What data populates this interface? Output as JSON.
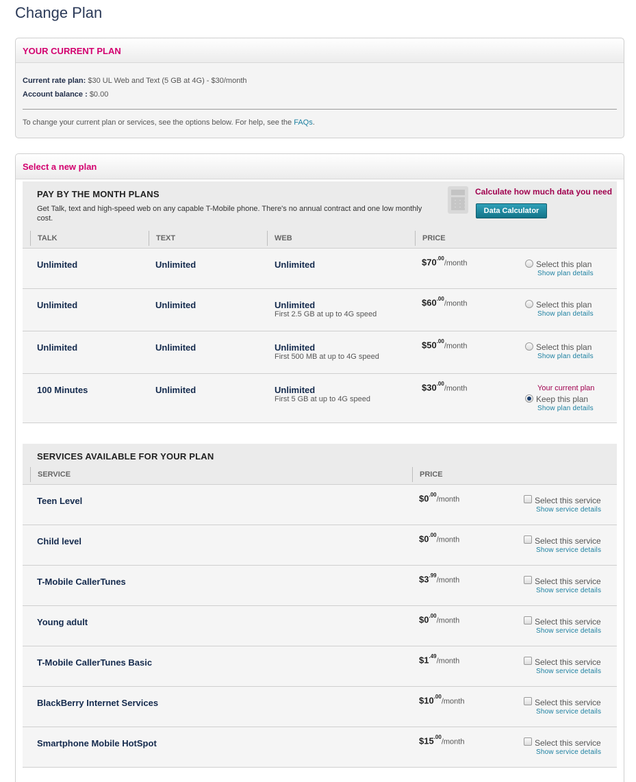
{
  "page_title": "Change Plan",
  "current_plan": {
    "heading": "YOUR CURRENT PLAN",
    "rate_plan_label": "Current rate plan:",
    "rate_plan_value": "$30 UL Web and Text (5 GB at 4G) - $30/month",
    "balance_label": "Account balance :",
    "balance_value": "$0.00",
    "help_text": "To change your current plan or services, see the options below. For help, see the",
    "help_link": "FAQs",
    "help_end": "."
  },
  "new_plan": {
    "heading": "Select a new plan",
    "month_plans": {
      "title": "PAY BY THE MONTH PLANS",
      "description": "Get Talk, text and high-speed web on any capable T-Mobile phone. There's no annual contract and one low monthly cost.",
      "calc_label": "Calculate how much data you need",
      "calc_button": "Data Calculator",
      "columns": [
        "TALK",
        "TEXT",
        "WEB",
        "PRICE"
      ],
      "rows": [
        {
          "talk": "Unlimited",
          "text": "Unlimited",
          "web": "Unlimited",
          "web_note": "",
          "price_main": "$70",
          "price_cents": ".00",
          "price_per": "/month",
          "note": "",
          "option": "Select this plan",
          "details": "Show plan details",
          "selected": false
        },
        {
          "talk": "Unlimited",
          "text": "Unlimited",
          "web": "Unlimited",
          "web_note": "First 2.5 GB at up to 4G speed",
          "price_main": "$60",
          "price_cents": ".00",
          "price_per": "/month",
          "note": "",
          "option": "Select this plan",
          "details": "Show plan details",
          "selected": false
        },
        {
          "talk": "Unlimited",
          "text": "Unlimited",
          "web": "Unlimited",
          "web_note": "First 500 MB at up to 4G speed",
          "price_main": "$50",
          "price_cents": ".00",
          "price_per": "/month",
          "note": "",
          "option": "Select this plan",
          "details": "Show plan details",
          "selected": false
        },
        {
          "talk": "100 Minutes",
          "text": "Unlimited",
          "web": "Unlimited",
          "web_note": "First 5 GB at up to 4G speed",
          "price_main": "$30",
          "price_cents": ".00",
          "price_per": "/month",
          "note": "Your current plan",
          "option": "Keep this plan",
          "details": "Show plan details",
          "selected": true
        }
      ]
    },
    "services": {
      "title": "SERVICES AVAILABLE FOR YOUR PLAN",
      "columns": [
        "SERVICE",
        "PRICE"
      ],
      "rows": [
        {
          "name": "Teen Level",
          "price_main": "$0",
          "price_cents": ".00",
          "price_per": "/month",
          "option": "Select this service",
          "details": "Show service details"
        },
        {
          "name": "Child level",
          "price_main": "$0",
          "price_cents": ".00",
          "price_per": "/month",
          "option": "Select this service",
          "details": "Show service details"
        },
        {
          "name": "T-Mobile CallerTunes",
          "price_main": "$3",
          "price_cents": ".99",
          "price_per": "/month",
          "option": "Select this service",
          "details": "Show service details"
        },
        {
          "name": "Young adult",
          "price_main": "$0",
          "price_cents": ".00",
          "price_per": "/month",
          "option": "Select this service",
          "details": "Show service details"
        },
        {
          "name": "T-Mobile CallerTunes Basic",
          "price_main": "$1",
          "price_cents": ".49",
          "price_per": "/month",
          "option": "Select this service",
          "details": "Show service details"
        },
        {
          "name": "BlackBerry Internet Services",
          "price_main": "$10",
          "price_cents": ".00",
          "price_per": "/month",
          "option": "Select this service",
          "details": "Show service details"
        },
        {
          "name": "Smartphone Mobile HotSpot",
          "price_main": "$15",
          "price_cents": ".00",
          "price_per": "/month",
          "option": "Select this service",
          "details": "Show service details"
        }
      ]
    }
  }
}
